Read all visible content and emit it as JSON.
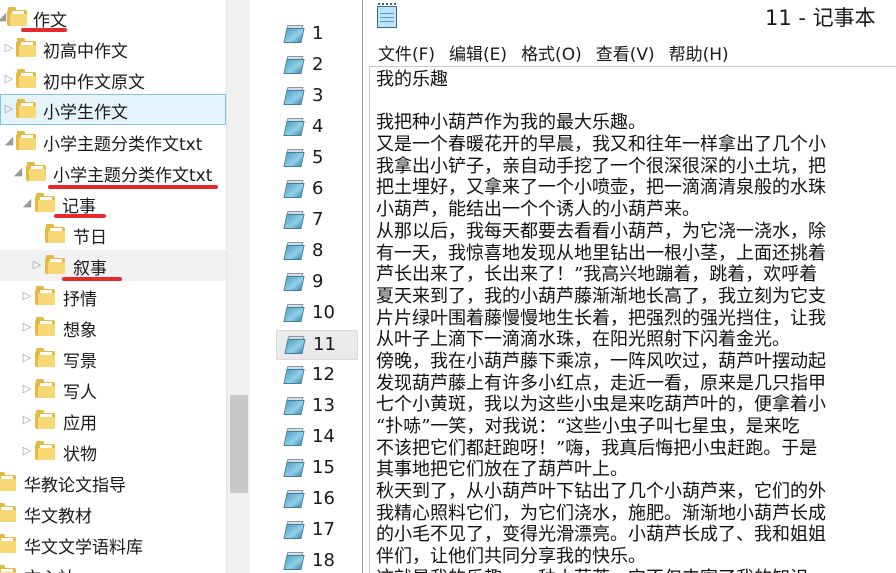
{
  "tree": {
    "items": [
      {
        "label": "作文"
      },
      {
        "label": "初高中作文"
      },
      {
        "label": "初中作文原文"
      },
      {
        "label": "小学生作文"
      },
      {
        "label": "小学主题分类作文txt"
      },
      {
        "label": "小学主题分类作文txt"
      },
      {
        "label": "记事"
      },
      {
        "label": "节日"
      },
      {
        "label": "叙事"
      },
      {
        "label": "抒情"
      },
      {
        "label": "想象"
      },
      {
        "label": "写景"
      },
      {
        "label": "写人"
      },
      {
        "label": "应用"
      },
      {
        "label": "状物"
      },
      {
        "label": "华教论文指导"
      },
      {
        "label": "华文教材"
      },
      {
        "label": "华文文学语料库"
      },
      {
        "label": "文心社"
      }
    ]
  },
  "files": {
    "items": [
      {
        "label": "1"
      },
      {
        "label": "2"
      },
      {
        "label": "3"
      },
      {
        "label": "4"
      },
      {
        "label": "5"
      },
      {
        "label": "6"
      },
      {
        "label": "7"
      },
      {
        "label": "8"
      },
      {
        "label": "9"
      },
      {
        "label": "10"
      },
      {
        "label": "11"
      },
      {
        "label": "12"
      },
      {
        "label": "13"
      },
      {
        "label": "14"
      },
      {
        "label": "15"
      },
      {
        "label": "16"
      },
      {
        "label": "17"
      },
      {
        "label": "18"
      }
    ]
  },
  "notepad": {
    "title": "11 - 记事本",
    "menu": {
      "file": "文件(F)",
      "edit": "编辑(E)",
      "format": "格式(O)",
      "view": "查看(V)",
      "help": "帮助(H)"
    },
    "lines": [
      "我的乐趣",
      "",
      "我把种小葫芦作为我的最大乐趣。",
      "又是一个春暖花开的早晨，我又和往年一样拿出了几个小",
      "我拿出小铲子，亲自动手挖了一个很深很深的小土坑，把",
      "把土埋好，又拿来了一个小喷壶，把一滴滴清泉般的水珠",
      "小葫芦，能结出一个个诱人的小葫芦来。",
      "从那以后，我每天都要去看看小葫芦，为它浇一浇水，除",
      "有一天，我惊喜地发现从地里钻出一根小茎，上面还挑着",
      "芦长出来了，长出来了！”我高兴地蹦着，跳着，欢呼着",
      "夏天来到了，我的小葫芦藤渐渐地长高了，我立刻为它支",
      "片片绿叶围着藤慢慢地生长着，把强烈的强光挡住，让我",
      "从叶子上滴下一滴滴水珠，在阳光照射下闪着金光。",
      "傍晚，我在小葫芦藤下乘凉，一阵风吹过，葫芦叶摆动起",
      "发现葫芦藤上有许多小红点，走近一看，原来是几只指甲",
      "七个小黄斑，我以为这些小虫是来吃葫芦叶的，便拿着小",
      "“扑哧”一笑，对我说：“这些小虫子叫七星虫，是来吃",
      "不该把它们都赶跑呀！”嗨，我真后悔把小虫赶跑。于是",
      "其事地把它们放在了葫芦叶上。",
      "秋天到了，从小葫芦叶下钻出了几个小葫芦来，它们的外",
      "我精心照料它们，为它们浇水，施肥。渐渐地小葫芦长成",
      "的小毛不见了，变得光滑漂亮。小葫芦长成了、我和姐姐",
      "伴们，让他们共同分享我的快乐。",
      "这就是我的乐趣——种小葫芦。它不仅丰富了我的知识，"
    ]
  },
  "colors": {
    "selection": "#e5f3fb",
    "selection_border": "#7fc3e7",
    "annotation_red": "#e8282a",
    "folder_yellow": "#f8d775"
  }
}
